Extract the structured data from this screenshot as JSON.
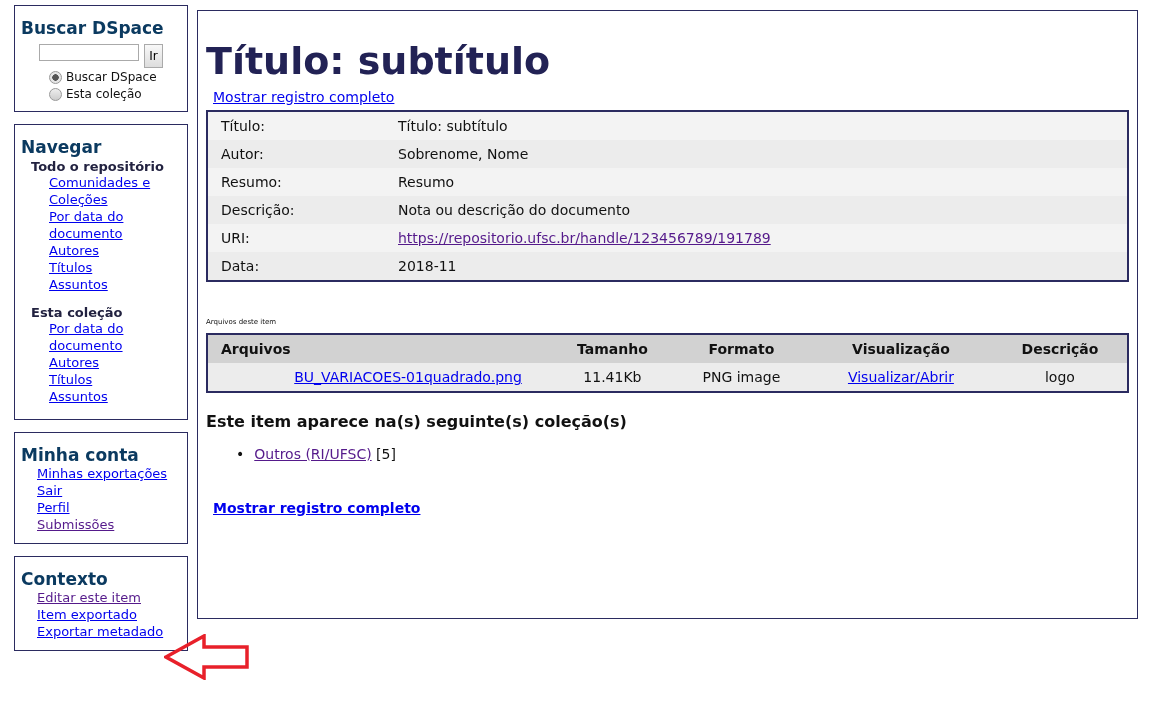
{
  "sidebar": {
    "search": {
      "title": "Buscar DSpace",
      "button": "Ir",
      "options": [
        {
          "label": "Buscar DSpace",
          "selected": true
        },
        {
          "label": "Esta coleção",
          "selected": false
        }
      ]
    },
    "navigate": {
      "title": "Navegar",
      "groups": [
        {
          "title": "Todo o repositório",
          "links": [
            {
              "label": "Comunidades e Coleções",
              "visited": false
            },
            {
              "label": "Por data do documento",
              "visited": false
            },
            {
              "label": "Autores",
              "visited": false
            },
            {
              "label": "Títulos",
              "visited": false
            },
            {
              "label": "Assuntos",
              "visited": false
            }
          ]
        },
        {
          "title": "Esta coleção",
          "links": [
            {
              "label": "Por data do documento",
              "visited": false
            },
            {
              "label": "Autores",
              "visited": false
            },
            {
              "label": "Títulos",
              "visited": false
            },
            {
              "label": "Assuntos",
              "visited": false
            }
          ]
        }
      ]
    },
    "account": {
      "title": "Minha conta",
      "links": [
        {
          "label": "Minhas exportações",
          "visited": false
        },
        {
          "label": "Sair",
          "visited": false
        },
        {
          "label": "Perfil",
          "visited": false
        },
        {
          "label": "Submissões",
          "visited": true
        }
      ]
    },
    "context": {
      "title": "Contexto",
      "links": [
        {
          "label": "Editar este item",
          "visited": true
        },
        {
          "label": "Item exportado",
          "visited": false
        },
        {
          "label": "Exportar metadado",
          "visited": false
        }
      ]
    }
  },
  "main": {
    "title": "Título: subtítulo",
    "show_full_top": "Mostrar registro completo",
    "metadata": [
      {
        "label": "Título:",
        "value": "Título: subtítulo",
        "kind": "text"
      },
      {
        "label": "Autor:",
        "value": "Sobrenome, Nome",
        "kind": "text"
      },
      {
        "label": "Resumo:",
        "value": "Resumo",
        "kind": "text"
      },
      {
        "label": "Descrição:",
        "value": "Nota ou descrição do documento",
        "kind": "text"
      },
      {
        "label": "URI:",
        "value": "https://repositorio.ufsc.br/handle/123456789/191789",
        "kind": "link",
        "visited": true
      },
      {
        "label": "Data:",
        "value": "2018-11",
        "kind": "text"
      }
    ],
    "files_caption": "Arquivos deste item",
    "files_columns": [
      "Arquivos",
      "Tamanho",
      "Formato",
      "Visualização",
      "Descrição"
    ],
    "files": [
      {
        "name": "BU_VARIACOES-01quadrado.png",
        "size": "11.41Kb",
        "format": "PNG image",
        "view": "Visualizar/Abrir",
        "description": "logo"
      }
    ],
    "collections_heading": "Este item aparece na(s) seguinte(s) coleção(s)",
    "collections": [
      {
        "bullet": "•",
        "label": "Outros (RI/UFSC)",
        "count": "[5]",
        "visited": true
      }
    ],
    "show_full_bottom": "Mostrar registro completo"
  }
}
